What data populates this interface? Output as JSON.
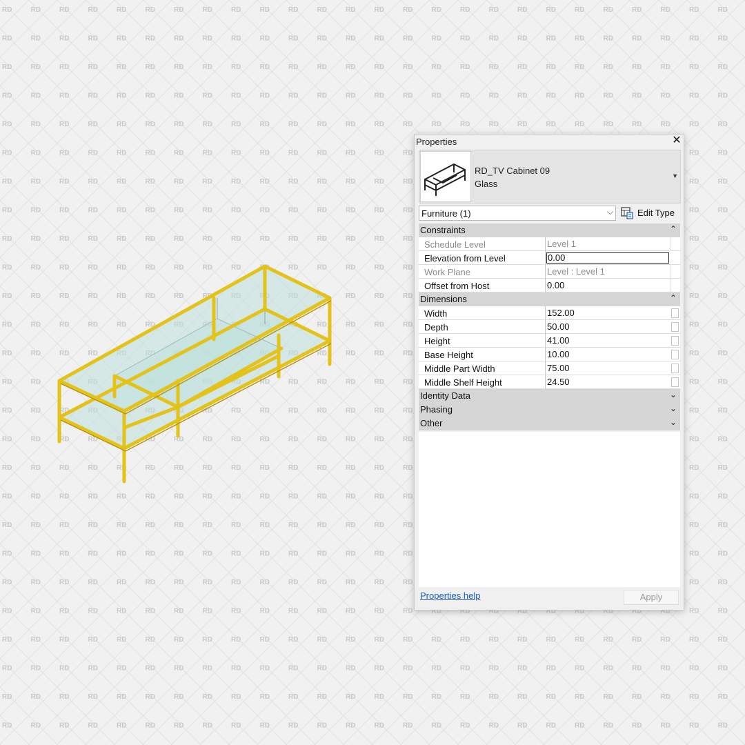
{
  "properties_panel": {
    "title": "Properties",
    "close_glyph": "✕",
    "type_selector": {
      "family_name": "RD_TV Cabinet 09",
      "type_name": "Glass",
      "dropdown_icon": "triangle-down-icon"
    },
    "instance_filter": "Furniture (1)",
    "edit_type_label": "Edit Type",
    "groups": {
      "constraints": {
        "label": "Constraints",
        "expanded": true,
        "rows": [
          {
            "name": "Schedule Level",
            "value": "Level 1",
            "readonly": true
          },
          {
            "name": "Elevation from Level",
            "value": "0.00",
            "active": true
          },
          {
            "name": "Work Plane",
            "value": "Level : Level 1",
            "readonly": true
          },
          {
            "name": "Offset from Host",
            "value": "0.00"
          }
        ]
      },
      "dimensions": {
        "label": "Dimensions",
        "expanded": true,
        "rows": [
          {
            "name": "Width",
            "value": "152.00"
          },
          {
            "name": "Depth",
            "value": "50.00"
          },
          {
            "name": "Height",
            "value": "41.00"
          },
          {
            "name": "Base Height",
            "value": "10.00"
          },
          {
            "name": "Middle Part Width",
            "value": "75.00"
          },
          {
            "name": "Middle Shelf Height",
            "value": "24.50"
          }
        ]
      },
      "identity_data": {
        "label": "Identity Data",
        "expanded": false
      },
      "phasing": {
        "label": "Phasing",
        "expanded": false
      },
      "other": {
        "label": "Other",
        "expanded": false
      }
    },
    "collapse_glyph": "⌃",
    "expand_glyph": "⌄",
    "help_link": "Properties help",
    "apply_label": "Apply"
  },
  "colors": {
    "background": "#f1f1f1",
    "watermark": "#c9c9c9",
    "frame_gold": "#e3c21a",
    "glass": "#bfe0dc",
    "group_header": "#d5d5d5"
  },
  "watermark_text": "RD"
}
